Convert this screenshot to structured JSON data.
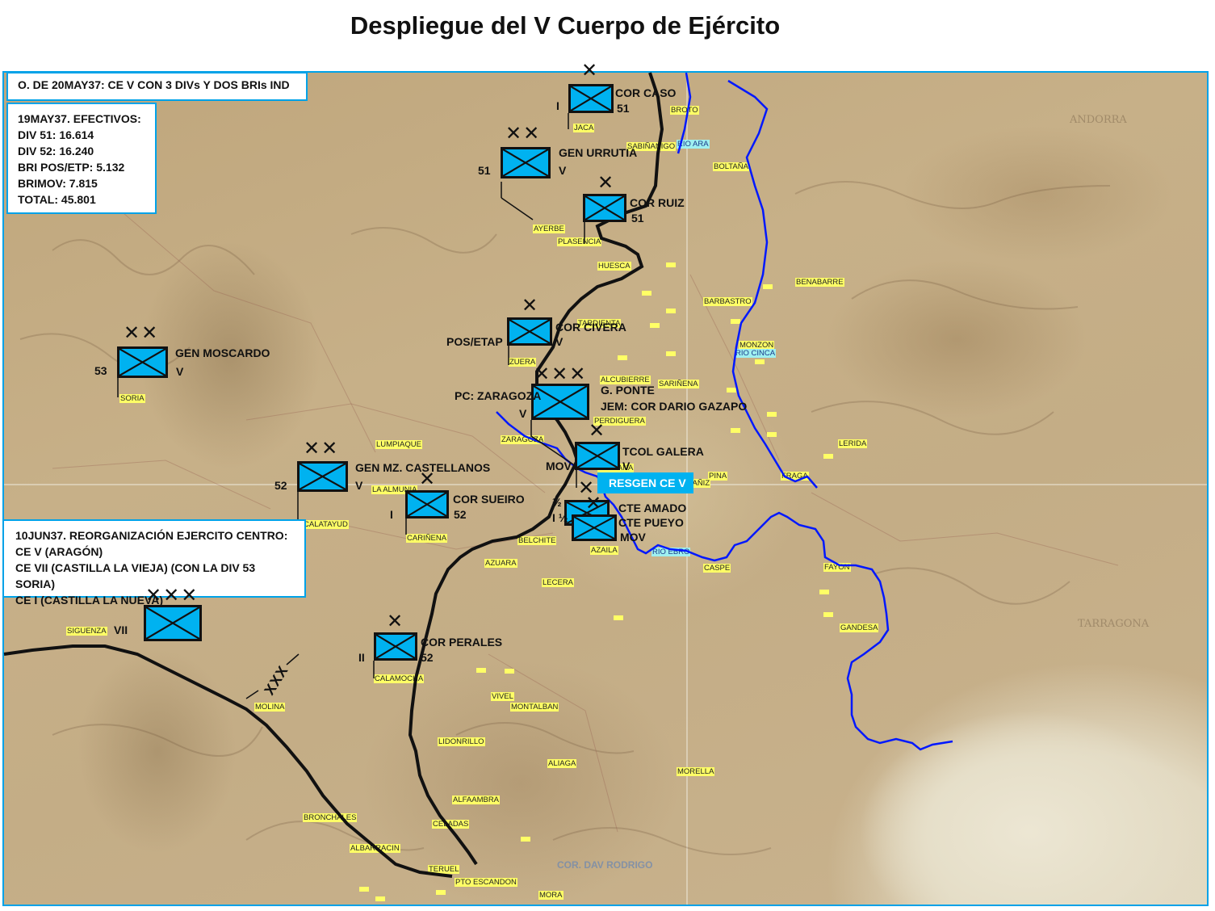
{
  "title": "Despliegue del V Cuerpo de Ejército",
  "info_boxes": {
    "order": "O. DE 20MAY37: CE V CON 3 DIVs Y DOS BRIs IND",
    "strength": {
      "heading": "19MAY37. EFECTIVOS:",
      "lines": [
        "DIV 51: 16.614",
        "DIV 52: 16.240",
        "BRI POS/ETP: 5.132",
        "BRIMOV: 7.815",
        "TOTAL: 45.801"
      ]
    },
    "reorg": {
      "heading": "10JUN37. REORGANIZACIÓN EJERCITO CENTRO:",
      "lines": [
        "CE V (ARAGÓN)",
        "CE VII (CASTILLA LA VIEJA) (CON LA DIV 53 SORIA)",
        "CE I (CASTILLA LA NUEVA)"
      ]
    }
  },
  "reserve_box": "RESGEN CE V",
  "boundary_label": "XXX",
  "watermark": "COR. DAV RODRIGO",
  "units": {
    "caso": {
      "echelon": "✕",
      "left": "I",
      "name": "COR CASO",
      "parent": "51"
    },
    "urrutia": {
      "echelon": "✕✕",
      "left": "51",
      "name": "GEN URRUTIA",
      "parent": "V"
    },
    "ruiz": {
      "echelon": "✕",
      "left": "",
      "name": "COR RUIZ",
      "parent": "51"
    },
    "civera": {
      "echelon": "✕",
      "left": "POS/ETAP",
      "name": "COR CIVERA",
      "parent": "V"
    },
    "moscardo": {
      "echelon": "✕✕",
      "left": "53",
      "name": "GEN MOSCARDO",
      "parent": "V"
    },
    "ponte": {
      "echelon": "✕✕✕",
      "left": "PC: ZARAGOZA",
      "name": "G. PONTE",
      "sub": "JEM: COR DARIO GAZAPO",
      "parent": "V"
    },
    "galera": {
      "echelon": "✕",
      "left": "MOV",
      "name": "TCOL GALERA",
      "parent": "V"
    },
    "castellanos": {
      "echelon": "✕✕",
      "left": "52",
      "name": "GEN MZ. CASTELLANOS",
      "parent": "V"
    },
    "sueiro": {
      "echelon": "✕",
      "left": "I",
      "name": "COR SUEIRO",
      "parent": "52"
    },
    "amado": {
      "echelon": "✕",
      "left": "½",
      "name": "CTE AMADO",
      "parent": "MOV"
    },
    "pueyo": {
      "echelon": "✕",
      "left": "I ½",
      "name": "CTE PUEYO",
      "parent": "MOV"
    },
    "vii": {
      "echelon": "✕✕✕",
      "left": "VII",
      "name": "",
      "parent": ""
    },
    "perales": {
      "echelon": "✕",
      "left": "II",
      "name": "COR PERALES",
      "parent": "52"
    }
  },
  "rivers": [
    "RIO ARA",
    "RIO CINCA",
    "RIO EBRO"
  ],
  "places": [
    "BROTO",
    "JACA",
    "SABIÑANIGO",
    "BOLTAÑA",
    "AYERBE",
    "PLASENCIA",
    "HUESCA",
    "BARBASTRO",
    "BENABARRE",
    "MONZON",
    "TARDIENTA",
    "ZUERA",
    "ALCUBIERRE",
    "SARIÑENA",
    "LERIDA",
    "FRAGA",
    "PERDIGUERA",
    "ZARAGOZA",
    "LUMPIAQUE",
    "LA ALMUNIA",
    "CALATAYUD",
    "CARIÑENA",
    "BELCHITE",
    "AZAILA",
    "AZUARA",
    "CASPE",
    "LECERA",
    "FAYON",
    "GANDESA",
    "SORIA",
    "SIGUENZA",
    "CALAMOCHA",
    "MOLINA",
    "VIVEL",
    "MONTALBAN",
    "LIDONRILLO",
    "ALIAGA",
    "MORELLA",
    "ALFAAMBRA",
    "CELADAS",
    "BRONCHALES",
    "ALBARRACIN",
    "TERUEL",
    "PTO ESCANDON",
    "MORA",
    "PINA",
    "MEDIANA",
    "ALCAÑIZ"
  ]
}
